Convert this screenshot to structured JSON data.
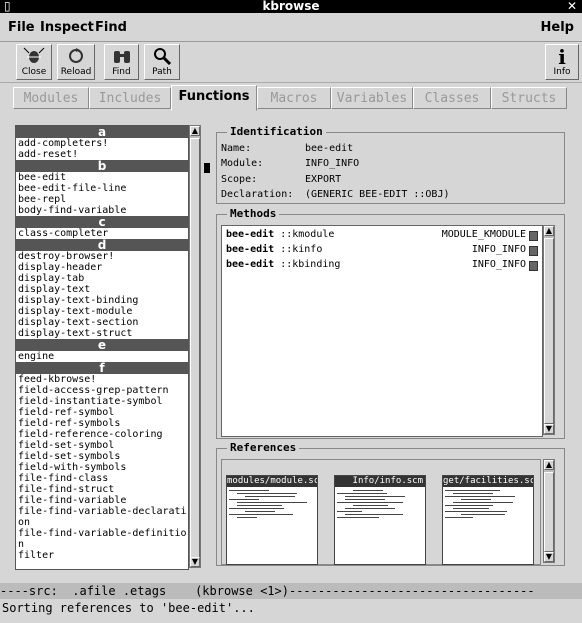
{
  "window": {
    "title": "kbrowse",
    "left_glyph": "▯",
    "close_glyph": "✕"
  },
  "menu": {
    "file": "File",
    "inspect": "Inspect",
    "find": "Find",
    "help": "Help"
  },
  "toolbar": {
    "close": {
      "label": "Close",
      "icon": "bee-icon"
    },
    "reload": {
      "label": "Reload",
      "icon": "reload-icon"
    },
    "find": {
      "label": "Find",
      "icon": "binoculars-icon"
    },
    "path": {
      "label": "Path",
      "icon": "magnifier-icon"
    },
    "info": {
      "label": "Info",
      "icon": "info-icon"
    }
  },
  "tabs": [
    {
      "label": "Modules",
      "active": false
    },
    {
      "label": "Includes",
      "active": false
    },
    {
      "label": "Functions",
      "active": true
    },
    {
      "label": "Macros",
      "active": false
    },
    {
      "label": "Variables",
      "active": false
    },
    {
      "label": "Classes",
      "active": false
    },
    {
      "label": "Structs",
      "active": false
    }
  ],
  "function_list": [
    {
      "type": "group",
      "text": "a"
    },
    {
      "type": "item",
      "text": "add-completers!"
    },
    {
      "type": "item",
      "text": "add-reset!"
    },
    {
      "type": "group",
      "text": "b"
    },
    {
      "type": "item",
      "text": "bee-edit"
    },
    {
      "type": "item",
      "text": "bee-edit-file-line"
    },
    {
      "type": "item",
      "text": "bee-repl"
    },
    {
      "type": "item",
      "text": "body-find-variable"
    },
    {
      "type": "group",
      "text": "c"
    },
    {
      "type": "item",
      "text": "class-completer"
    },
    {
      "type": "group",
      "text": "d"
    },
    {
      "type": "item",
      "text": "destroy-browser!"
    },
    {
      "type": "item",
      "text": "display-header"
    },
    {
      "type": "item",
      "text": "display-tab"
    },
    {
      "type": "item",
      "text": "display-text"
    },
    {
      "type": "item",
      "text": "display-text-binding"
    },
    {
      "type": "item",
      "text": "display-text-module"
    },
    {
      "type": "item",
      "text": "display-text-section"
    },
    {
      "type": "item",
      "text": "display-text-struct"
    },
    {
      "type": "group",
      "text": "e"
    },
    {
      "type": "item",
      "text": "engine"
    },
    {
      "type": "group",
      "text": "f"
    },
    {
      "type": "item",
      "text": "feed-kbrowse!"
    },
    {
      "type": "item",
      "text": "field-access-grep-pattern"
    },
    {
      "type": "item",
      "text": "field-instantiate-symbol"
    },
    {
      "type": "item",
      "text": "field-ref-symbol"
    },
    {
      "type": "item",
      "text": "field-ref-symbols"
    },
    {
      "type": "item",
      "text": "field-reference-coloring"
    },
    {
      "type": "item",
      "text": "field-set-symbol"
    },
    {
      "type": "item",
      "text": "field-set-symbols"
    },
    {
      "type": "item",
      "text": "field-with-symbols"
    },
    {
      "type": "item",
      "text": "file-find-class"
    },
    {
      "type": "item",
      "text": "file-find-struct"
    },
    {
      "type": "item",
      "text": "file-find-variable"
    },
    {
      "type": "item",
      "text": "file-find-variable-declarati"
    },
    {
      "type": "item",
      "text": "on"
    },
    {
      "type": "item",
      "text": "file-find-variable-definitio"
    },
    {
      "type": "item",
      "text": "n"
    },
    {
      "type": "item",
      "text": "filter"
    }
  ],
  "identification": {
    "legend": "Identification",
    "rows": [
      {
        "key": "Name:",
        "value": "bee-edit"
      },
      {
        "key": "Module:",
        "value": "INFO_INFO"
      },
      {
        "key": "Scope:",
        "value": "EXPORT"
      },
      {
        "key": "Declaration:",
        "value": "(GENERIC BEE-EDIT ::OBJ)"
      }
    ]
  },
  "methods": {
    "legend": "Methods",
    "rows": [
      {
        "name": "bee-edit",
        "type": " ::kmodule",
        "module": "MODULE_KMODULE"
      },
      {
        "name": "bee-edit",
        "type": " ::kinfo",
        "module": "INFO_INFO"
      },
      {
        "name": "bee-edit",
        "type": " ::kbinding",
        "module": "INFO_INFO"
      }
    ]
  },
  "references": {
    "legend": "References",
    "files": [
      "modules/module.scm",
      "Info/info.scm",
      "get/facilities.scm"
    ]
  },
  "status": {
    "modeline": "----src:  .afile .etags    (kbrowse <1>)----------------------------------",
    "message": "Sorting references to 'bee-edit'..."
  }
}
